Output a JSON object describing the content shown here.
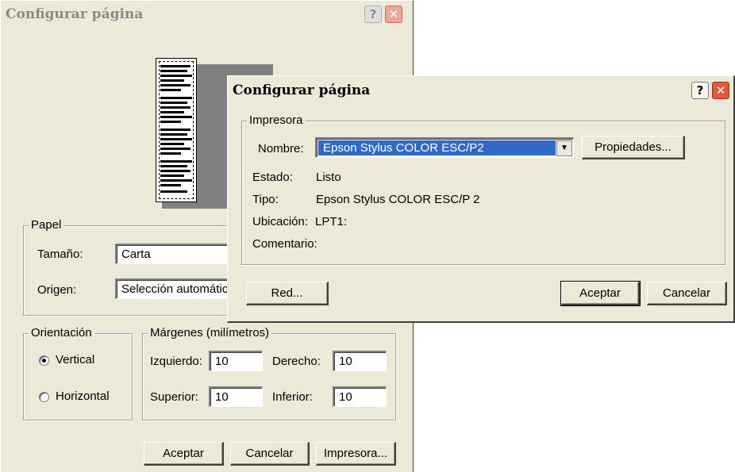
{
  "back_dialog": {
    "title": "Configurar página",
    "paper": {
      "group_label": "Papel",
      "size_label": "Tamaño:",
      "size_value": "Carta",
      "source_label": "Origen:",
      "source_value": "Selección automátic"
    },
    "orientation": {
      "group_label": "Orientación",
      "portrait_label": "Vertical",
      "landscape_label": "Horizontal",
      "selected": "Vertical"
    },
    "margins": {
      "group_label": "Márgenes (milímetros)",
      "left_label": "Izquierdo:",
      "left_value": "10",
      "right_label": "Derecho:",
      "right_value": "10",
      "top_label": "Superior:",
      "top_value": "10",
      "bottom_label": "Inferior:",
      "bottom_value": "10"
    },
    "buttons": {
      "ok": "Aceptar",
      "cancel": "Cancelar",
      "printer": "Impresora..."
    }
  },
  "front_dialog": {
    "title": "Configurar página",
    "printer_group_label": "Impresora",
    "name_label": "Nombre:",
    "name_value": "Epson Stylus COLOR ESC/P2",
    "properties_button": "Propiedades...",
    "status_label": "Estado:",
    "status_value": "Listo",
    "type_label": "Tipo:",
    "type_value": "Epson Stylus COLOR ESC/P 2",
    "location_label": "Ubicación:",
    "location_value": "LPT1:",
    "comment_label": "Comentario:",
    "comment_value": "",
    "buttons": {
      "network": "Red...",
      "ok": "Aceptar",
      "cancel": "Cancelar"
    }
  },
  "icons": {
    "help": "?",
    "close": "✕",
    "dropdown": "▼"
  },
  "colors": {
    "dialog_bg": "#ece9d8",
    "inactive_title": "#808080",
    "close_button": "#e05a3c"
  }
}
